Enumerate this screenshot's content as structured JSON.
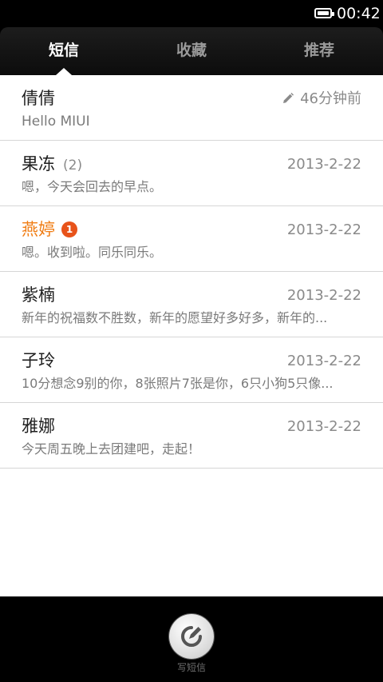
{
  "status_bar": {
    "time": "00:42",
    "battery_icon": "battery-icon"
  },
  "tabs": [
    {
      "label": "短信",
      "active": true
    },
    {
      "label": "收藏",
      "active": false
    },
    {
      "label": "推荐",
      "active": false
    }
  ],
  "conversations": [
    {
      "name": "倩倩",
      "count": "",
      "badge": "",
      "time": "46分钟前",
      "draft_icon": "pencil-icon",
      "preview": "Hello MIUI",
      "unread": false
    },
    {
      "name": "果冻",
      "count": "(2)",
      "badge": "",
      "time": "2013-2-22",
      "preview": "嗯，今天会回去的早点。",
      "unread": false
    },
    {
      "name": "燕婷",
      "count": "",
      "badge": "1",
      "time": "2013-2-22",
      "preview": "嗯。收到啦。同乐同乐。",
      "unread": true
    },
    {
      "name": "紫楠",
      "count": "",
      "badge": "",
      "time": "2013-2-22",
      "preview": "新年的祝福数不胜数，新年的愿望好多好多，新年的...",
      "unread": false
    },
    {
      "name": "子玲",
      "count": "",
      "badge": "",
      "time": "2013-2-22",
      "preview": "10分想念9别的你，8张照片7张是你，6只小狗5只像...",
      "unread": false
    },
    {
      "name": "雅娜",
      "count": "",
      "badge": "",
      "time": "2013-2-22",
      "preview": "今天周五晚上去团建吧，走起！",
      "unread": false
    }
  ],
  "colors": {
    "unread_name": "#f07d14",
    "badge": "#e8531a"
  },
  "bottom_bar": {
    "compose_label": "写短信",
    "compose_icon": "compose-icon"
  }
}
